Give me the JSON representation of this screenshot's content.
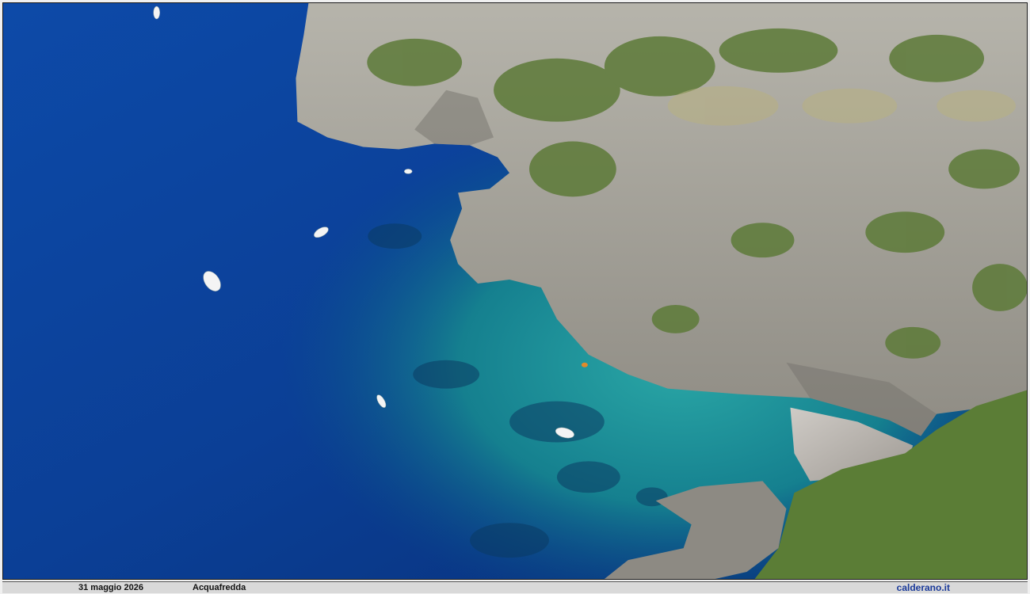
{
  "caption": {
    "date": "31 maggio 2026",
    "place": "Acquafredda",
    "site": "calderano.it"
  },
  "colors": {
    "deep_sea": "#0b3f96",
    "turquoise": "#1a8f9c",
    "cliff": "#a7a69e",
    "vegetation": "#5d7a38",
    "caption_bg": "#d9d9d9",
    "site_text": "#1a3a9a"
  }
}
